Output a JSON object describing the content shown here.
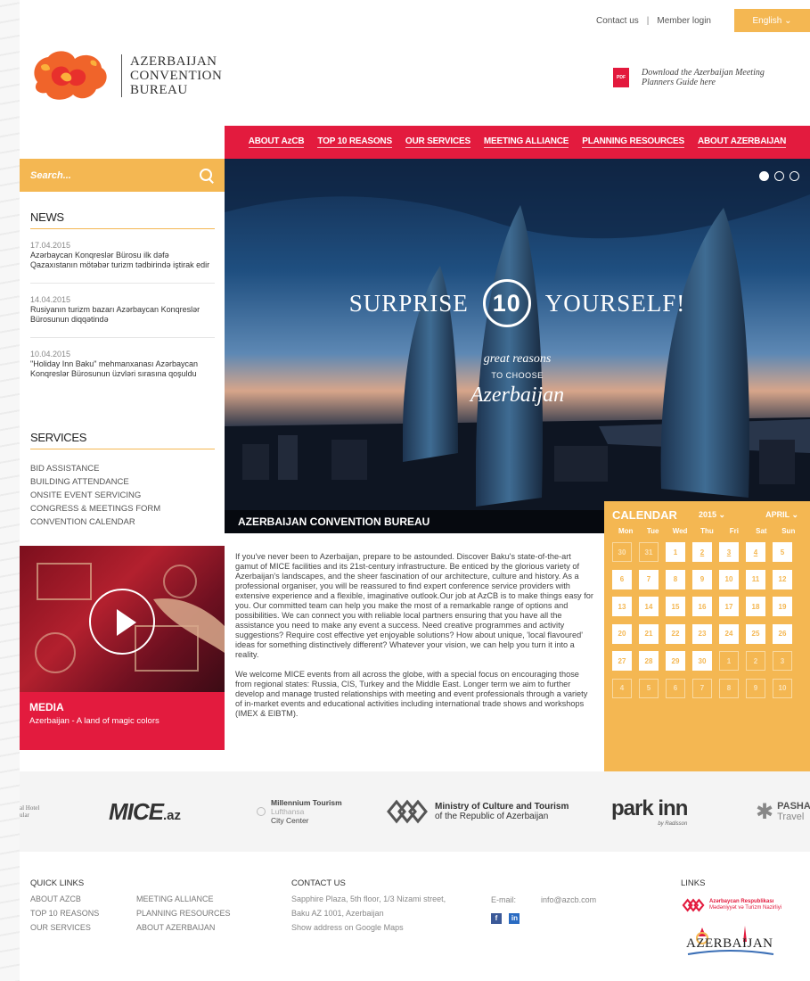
{
  "topbar": {
    "contact": "Contact us",
    "separator": "|",
    "member_login": "Member login",
    "language": "English ⌄"
  },
  "logo": {
    "line1": "AZERBAIJAN",
    "line2": "CONVENTION",
    "line3": "BUREAU"
  },
  "pdf": {
    "icon_label": "PDF",
    "text": "Download the Azerbaijan Meeting Planners Guide here"
  },
  "nav": {
    "items": [
      "ABOUT AzCB",
      "TOP 10 REASONS",
      "OUR SERVICES",
      "MEETING ALLIANCE",
      "PLANNING RESOURCES",
      "ABOUT AZERBAIJAN"
    ]
  },
  "search": {
    "placeholder": "Search..."
  },
  "news": {
    "title": "NEWS",
    "items": [
      {
        "date": "17.04.2015",
        "text": "Azərbaycan Konqreslər Bürosu ilk dəfə Qazaxıstanın mötəbər turizm tədbirində iştirak edir"
      },
      {
        "date": "14.04.2015",
        "text": "Rusiyanın turizm bazarı Azərbaycan Konqreslər Bürosunun diqqətində"
      },
      {
        "date": "10.04.2015",
        "text": "\"Holiday Inn Baku\" mehmanxanası Azərbaycan Konqreslər Bürosunun üzvləri sırasına qoşuldu"
      }
    ]
  },
  "services": {
    "title": "SERVICES",
    "items": [
      "BID ASSISTANCE",
      "BUILDING ATTENDANCE",
      "ONSITE EVENT SERVICING",
      "CONGRESS & MEETINGS FORM",
      "CONVENTION CALENDAR"
    ]
  },
  "hero": {
    "left_word": "SURPRISE",
    "number": "10",
    "right_word": "YOURSELF!",
    "sub1": "great reasons",
    "sub2": "TO CHOOSE",
    "sub3": "Azerbaijan",
    "caption": "AZERBAIJAN CONVENTION BUREAU",
    "slide_count": 3,
    "active_slide": 1
  },
  "calendar": {
    "title": "CALENDAR",
    "year": "2015 ⌄",
    "month": "APRIL ⌄",
    "days_of_week": [
      "Mon",
      "Tue",
      "Wed",
      "Thu",
      "Fri",
      "Sat",
      "Sun"
    ],
    "days": [
      {
        "n": "30",
        "muted": true
      },
      {
        "n": "31",
        "muted": true
      },
      {
        "n": "1"
      },
      {
        "n": "2",
        "event": true
      },
      {
        "n": "3",
        "event": true
      },
      {
        "n": "4",
        "event": true
      },
      {
        "n": "5"
      },
      {
        "n": "6"
      },
      {
        "n": "7"
      },
      {
        "n": "8"
      },
      {
        "n": "9"
      },
      {
        "n": "10"
      },
      {
        "n": "11"
      },
      {
        "n": "12"
      },
      {
        "n": "13"
      },
      {
        "n": "14"
      },
      {
        "n": "15"
      },
      {
        "n": "16"
      },
      {
        "n": "17"
      },
      {
        "n": "18"
      },
      {
        "n": "19"
      },
      {
        "n": "20"
      },
      {
        "n": "21"
      },
      {
        "n": "22"
      },
      {
        "n": "23"
      },
      {
        "n": "24"
      },
      {
        "n": "25"
      },
      {
        "n": "26"
      },
      {
        "n": "27"
      },
      {
        "n": "28"
      },
      {
        "n": "29"
      },
      {
        "n": "30"
      },
      {
        "n": "1",
        "muted": true
      },
      {
        "n": "2",
        "muted": true
      },
      {
        "n": "3",
        "muted": true
      },
      {
        "n": "4",
        "muted": true
      },
      {
        "n": "5",
        "muted": true
      },
      {
        "n": "6",
        "muted": true
      },
      {
        "n": "7",
        "muted": true
      },
      {
        "n": "8",
        "muted": true
      },
      {
        "n": "9",
        "muted": true
      },
      {
        "n": "10",
        "muted": true
      }
    ]
  },
  "media": {
    "title": "MEDIA",
    "subtitle": "Azerbaijan - A land of magic colors"
  },
  "intro": {
    "p1": "If you've never been to Azerbaijan, prepare to be astounded. Discover Baku's state-of-the-art gamut of MICE facilities and its 21st-century infrastructure. Be enticed by the glorious variety of Azerbaijan's landscapes, and the sheer fascination of our architecture, culture and history. As a professional organiser, you will be reassured to find expert conference service providers with extensive experience and a flexible, imaginative outlook.Our job at AzCB is to make things easy for you. Our committed team can help you make the most of a remarkable range of options and possibilities. We can connect you with reliable local partners ensuring that you have all the assistance you need to make any event a success. Need creative programmes and activity suggestions? Require cost effective yet enjoyable solutions? How about unique, 'local flavoured' ideas for something distinctively different? Whatever your vision, we can help you turn it into a reality.",
    "p2": "We welcome MICE events from all across the globe, with a special focus on encouraging those from regional states: Russia, CIS, Turkey and the Middle East. Longer term we aim to further develop and manage trusted relationships with meeting and event professionals through a variety of in-market events and educational activities including international trade shows and workshops (IMEX & EIBTM)."
  },
  "partners": {
    "p0a": "al Hotel",
    "p0b": "ular",
    "mice": "MICE",
    "mice_suffix": ".az",
    "millennium1": "Millennium Tourism",
    "millennium2": "Lufthansa",
    "millennium3": "City Center",
    "ministry1": "Ministry of Culture and Tourism",
    "ministry2": "of the Republic of Azerbaijan",
    "parkinn": "park inn",
    "parkinn_sub": "by Radisson",
    "pasha1": "PASHA",
    "pasha2": "Travel"
  },
  "footer": {
    "quick_links_title": "QUICK LINKS",
    "quick_links_col1": [
      "ABOUT AzCB",
      "TOP 10 REASONS",
      "OUR SERVICES"
    ],
    "quick_links_col2": [
      "MEETING ALLIANCE",
      "PLANNING RESOURCES",
      "ABOUT AZERBAIJAN"
    ],
    "contact_title": "CONTACT US",
    "address1": "Sapphire Plaza, 5th floor, 1/3 Nizami street,",
    "address2": "Baku AZ 1001, Azerbaijan",
    "map_link": "Show address on Google Maps",
    "email_label": "E-mail:",
    "email": "info@azcb.com",
    "facebook": "f",
    "linkedin": "in",
    "links_title": "LINKS",
    "ministry_link1": "Azərbaycan Respublikası",
    "ministry_link2": "Mədəniyyət və Turizm Nazirliyi",
    "azerbaijan_logo": "AZERBAIJAN"
  },
  "colors": {
    "accent_yellow": "#f4b752",
    "accent_red": "#e31b3e"
  }
}
